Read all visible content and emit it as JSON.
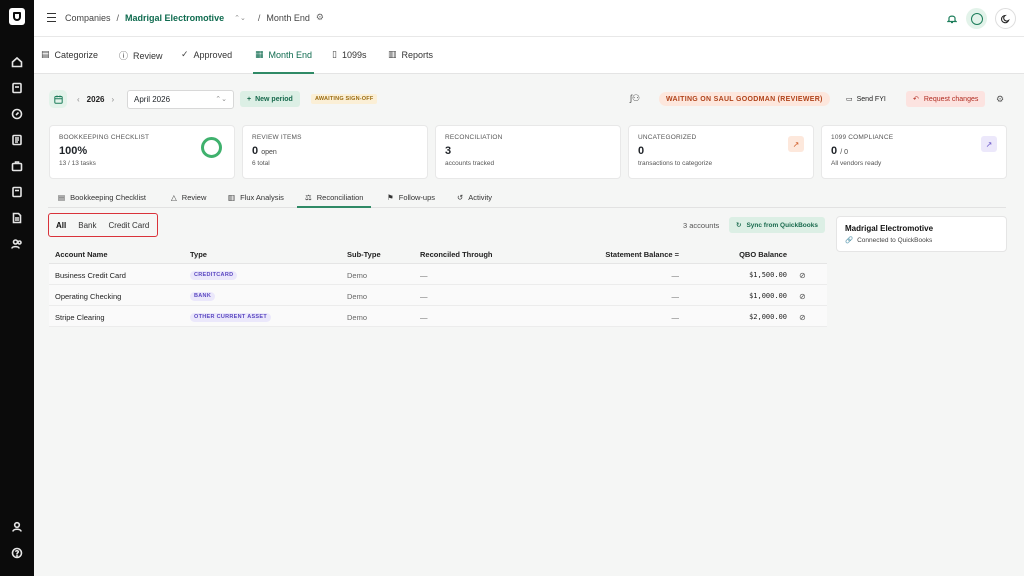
{
  "breadcrumb": {
    "root": "Companies",
    "company": "Madrigal Electromotive",
    "page": "Month End"
  },
  "nav": {
    "tabs": [
      {
        "label": "Categorize",
        "icon": "inbox-icon"
      },
      {
        "label": "Review",
        "icon": "info-icon"
      },
      {
        "label": "Approved",
        "icon": "check-circle-icon"
      },
      {
        "label": "Month End",
        "icon": "calendar-icon"
      },
      {
        "label": "1099s",
        "icon": "document-icon"
      },
      {
        "label": "Reports",
        "icon": "bar-chart-icon"
      }
    ],
    "active": "Month End"
  },
  "period": {
    "year": "2026",
    "month": "April 2026",
    "new_period": "New period",
    "status": "AWAITING SIGN-OFF",
    "waiting": "WAITING ON SAUL GOODMAN (REVIEWER)",
    "send_fyi": "Send FYI",
    "request_changes": "Request changes"
  },
  "cards": [
    {
      "label": "BOOKKEEPING CHECKLIST",
      "value": "100%",
      "value_suffix": "",
      "sub": "13 / 13 tasks"
    },
    {
      "label": "REVIEW ITEMS",
      "value": "0",
      "value_suffix": "open",
      "sub": "6 total"
    },
    {
      "label": "RECONCILIATION",
      "value": "3",
      "value_suffix": "",
      "sub": "accounts tracked"
    },
    {
      "label": "UNCATEGORIZED",
      "value": "0",
      "value_suffix": "",
      "sub": "transactions to categorize"
    },
    {
      "label": "1099 COMPLIANCE",
      "value": "0",
      "value_suffix": "/ 0",
      "sub": "All vendors ready"
    }
  ],
  "subtabs": [
    {
      "label": "Bookkeeping Checklist",
      "icon": "clipboard-icon"
    },
    {
      "label": "Review",
      "icon": "warning-icon"
    },
    {
      "label": "Flux Analysis",
      "icon": "bar-chart-icon"
    },
    {
      "label": "Reconciliation",
      "icon": "scale-icon"
    },
    {
      "label": "Follow-ups",
      "icon": "flag-icon"
    },
    {
      "label": "Activity",
      "icon": "history-icon"
    }
  ],
  "filters": [
    "All",
    "Bank",
    "Credit Card"
  ],
  "active_filter": "All",
  "account_count": "3 accounts",
  "sync_label": "Sync from QuickBooks",
  "table": {
    "headers": [
      "Account Name",
      "Type",
      "Sub-Type",
      "Reconciled Through",
      "Statement Balance =",
      "QBO Balance"
    ],
    "rows": [
      {
        "name": "Business Credit Card",
        "type": "CREDITCARD",
        "subtype": "Demo",
        "reconciled": "—",
        "statement": "—",
        "qbo": "$1,500.00"
      },
      {
        "name": "Operating Checking",
        "type": "BANK",
        "subtype": "Demo",
        "reconciled": "—",
        "statement": "—",
        "qbo": "$1,000.00"
      },
      {
        "name": "Stripe Clearing",
        "type": "OTHER CURRENT ASSET",
        "subtype": "Demo",
        "reconciled": "—",
        "statement": "—",
        "qbo": "$2,000.00"
      }
    ]
  },
  "side_card": {
    "name": "Madrigal Electromotive",
    "status": "Connected to QuickBooks"
  },
  "colors": {
    "brand_green": "#0f6b4f",
    "accent_bg": "#dcefe5",
    "filter_highlight": "#d9323a",
    "badge_purple": "#5a47c0"
  }
}
